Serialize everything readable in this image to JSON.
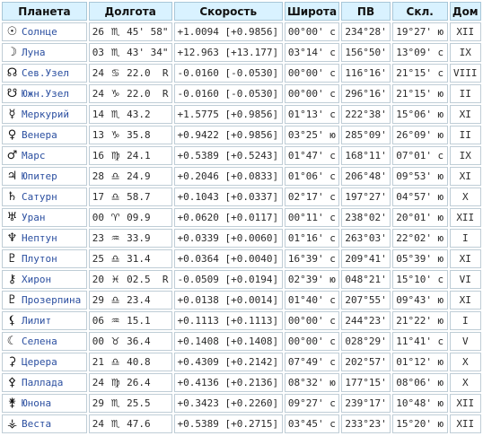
{
  "headers": {
    "planet": "Планета",
    "longitude": "Долгота",
    "speed": "Скорость",
    "latitude": "Широта",
    "ra": "ПВ",
    "dec": "Скл.",
    "house": "Дом"
  },
  "rows": [
    {
      "icon": "sun-icon",
      "glyph": "☉",
      "name": "Солнце",
      "deg": "26",
      "sign_icon": "scorpio-icon",
      "sign": "♏",
      "min": "45' 58\"",
      "speed": "+1.0094 [+0.9856]",
      "lat": "00°00' с",
      "ra": "234°28'",
      "dec": "19°27' ю",
      "house": "XII"
    },
    {
      "icon": "moon-icon",
      "glyph": "☽",
      "name": "Луна",
      "deg": "03",
      "sign_icon": "scorpio-icon",
      "sign": "♏",
      "min": "43' 34\"",
      "speed": "+12.963 [+13.177]",
      "lat": "03°14' с",
      "ra": "156°50'",
      "dec": "13°09' с",
      "house": "IX"
    },
    {
      "icon": "north-node-icon",
      "glyph": "☊",
      "name": "Сев.Узел",
      "deg": "24",
      "sign_icon": "cancer-icon",
      "sign": "♋",
      "min": "22.0  R",
      "speed": "-0.0160 [-0.0530]",
      "lat": "00°00' с",
      "ra": "116°16'",
      "dec": "21°15' с",
      "house": "VIII"
    },
    {
      "icon": "south-node-icon",
      "glyph": "☋",
      "name": "Южн.Узел",
      "deg": "24",
      "sign_icon": "capricorn-icon",
      "sign": "♑",
      "min": "22.0  R",
      "speed": "-0.0160 [-0.0530]",
      "lat": "00°00' с",
      "ra": "296°16'",
      "dec": "21°15' ю",
      "house": "II"
    },
    {
      "icon": "mercury-icon",
      "glyph": "☿",
      "name": "Меркурий",
      "deg": "14",
      "sign_icon": "scorpio-icon",
      "sign": "♏",
      "min": "43.2",
      "speed": "+1.5775 [+0.9856]",
      "lat": "01°13' с",
      "ra": "222°38'",
      "dec": "15°06' ю",
      "house": "XI"
    },
    {
      "icon": "venus-icon",
      "glyph": "♀",
      "name": "Венера",
      "deg": "13",
      "sign_icon": "capricorn-icon",
      "sign": "♑",
      "min": "35.8",
      "speed": "+0.9422 [+0.9856]",
      "lat": "03°25' ю",
      "ra": "285°09'",
      "dec": "26°09' ю",
      "house": "II"
    },
    {
      "icon": "mars-icon",
      "glyph": "♂",
      "name": "Марс",
      "deg": "16",
      "sign_icon": "virgo-icon",
      "sign": "♍",
      "min": "24.1",
      "speed": "+0.5389 [+0.5243]",
      "lat": "01°47' с",
      "ra": "168°11'",
      "dec": "07°01' с",
      "house": "IX"
    },
    {
      "icon": "jupiter-icon",
      "glyph": "♃",
      "name": "Юпитер",
      "deg": "28",
      "sign_icon": "libra-icon",
      "sign": "♎",
      "min": "24.9",
      "speed": "+0.2046 [+0.0833]",
      "lat": "01°06' с",
      "ra": "206°48'",
      "dec": "09°53' ю",
      "house": "XI"
    },
    {
      "icon": "saturn-icon",
      "glyph": "♄",
      "name": "Сатурн",
      "deg": "17",
      "sign_icon": "libra-icon",
      "sign": "♎",
      "min": "58.7",
      "speed": "+0.1043 [+0.0337]",
      "lat": "02°17' с",
      "ra": "197°27'",
      "dec": "04°57' ю",
      "house": "X"
    },
    {
      "icon": "uranus-icon",
      "glyph": "♅",
      "name": "Уран",
      "deg": "00",
      "sign_icon": "aries-icon",
      "sign": "♈",
      "min": "09.9",
      "speed": "+0.0620 [+0.0117]",
      "lat": "00°11' с",
      "ra": "238°02'",
      "dec": "20°01' ю",
      "house": "XII"
    },
    {
      "icon": "neptune-icon",
      "glyph": "♆",
      "name": "Нептун",
      "deg": "23",
      "sign_icon": "aquarius-icon",
      "sign": "♒",
      "min": "33.9",
      "speed": "+0.0339 [+0.0060]",
      "lat": "01°16' с",
      "ra": "263°03'",
      "dec": "22°02' ю",
      "house": "I"
    },
    {
      "icon": "pluto-icon",
      "glyph": "♇",
      "name": "Плутон",
      "deg": "25",
      "sign_icon": "libra-icon",
      "sign": "♎",
      "min": "31.4",
      "speed": "+0.0364 [+0.0040]",
      "lat": "16°39' с",
      "ra": "209°41'",
      "dec": "05°39' ю",
      "house": "XI"
    },
    {
      "icon": "chiron-icon",
      "glyph": "⚷",
      "name": "Хирон",
      "deg": "20",
      "sign_icon": "pisces-icon",
      "sign": "♓",
      "min": "02.5  R",
      "speed": "-0.0509 [+0.0194]",
      "lat": "02°39' ю",
      "ra": "048°21'",
      "dec": "15°10' с",
      "house": "VI"
    },
    {
      "icon": "proserpina-icon",
      "glyph": "♇",
      "name": "Прозерпина",
      "deg": "29",
      "sign_icon": "libra-icon",
      "sign": "♎",
      "min": "23.4",
      "speed": "+0.0138 [+0.0014]",
      "lat": "01°40' с",
      "ra": "207°55'",
      "dec": "09°43' ю",
      "house": "XI"
    },
    {
      "icon": "lilith-icon",
      "glyph": "⚸",
      "name": "Лилит",
      "deg": "06",
      "sign_icon": "aquarius-icon",
      "sign": "♒",
      "min": "15.1",
      "speed": "+0.1113 [+0.1113]",
      "lat": "00°00' с",
      "ra": "244°23'",
      "dec": "21°22' ю",
      "house": "I"
    },
    {
      "icon": "selena-icon",
      "glyph": "☾",
      "name": "Селена",
      "deg": "00",
      "sign_icon": "taurus-icon",
      "sign": "♉",
      "min": "36.4",
      "speed": "+0.1408 [+0.1408]",
      "lat": "00°00' с",
      "ra": "028°29'",
      "dec": "11°41' с",
      "house": "V"
    },
    {
      "icon": "ceres-icon",
      "glyph": "⚳",
      "name": "Церера",
      "deg": "21",
      "sign_icon": "libra-icon",
      "sign": "♎",
      "min": "40.8",
      "speed": "+0.4309 [+0.2142]",
      "lat": "07°49' с",
      "ra": "202°57'",
      "dec": "01°12' ю",
      "house": "X"
    },
    {
      "icon": "pallas-icon",
      "glyph": "⚴",
      "name": "Паллада",
      "deg": "24",
      "sign_icon": "virgo-icon",
      "sign": "♍",
      "min": "26.4",
      "speed": "+0.4136 [+0.2136]",
      "lat": "08°32' ю",
      "ra": "177°15'",
      "dec": "08°06' ю",
      "house": "X"
    },
    {
      "icon": "juno-icon",
      "glyph": "⚵",
      "name": "Юнона",
      "deg": "29",
      "sign_icon": "scorpio-icon",
      "sign": "♏",
      "min": "25.5",
      "speed": "+0.3423 [+0.2260]",
      "lat": "09°27' с",
      "ra": "239°17'",
      "dec": "10°48' ю",
      "house": "XII"
    },
    {
      "icon": "vesta-icon",
      "glyph": "⚶",
      "name": "Веста",
      "deg": "24",
      "sign_icon": "scorpio-icon",
      "sign": "♏",
      "min": "47.6",
      "speed": "+0.5389 [+0.2715]",
      "lat": "03°45' с",
      "ra": "233°23'",
      "dec": "15°20' ю",
      "house": "XII"
    }
  ]
}
